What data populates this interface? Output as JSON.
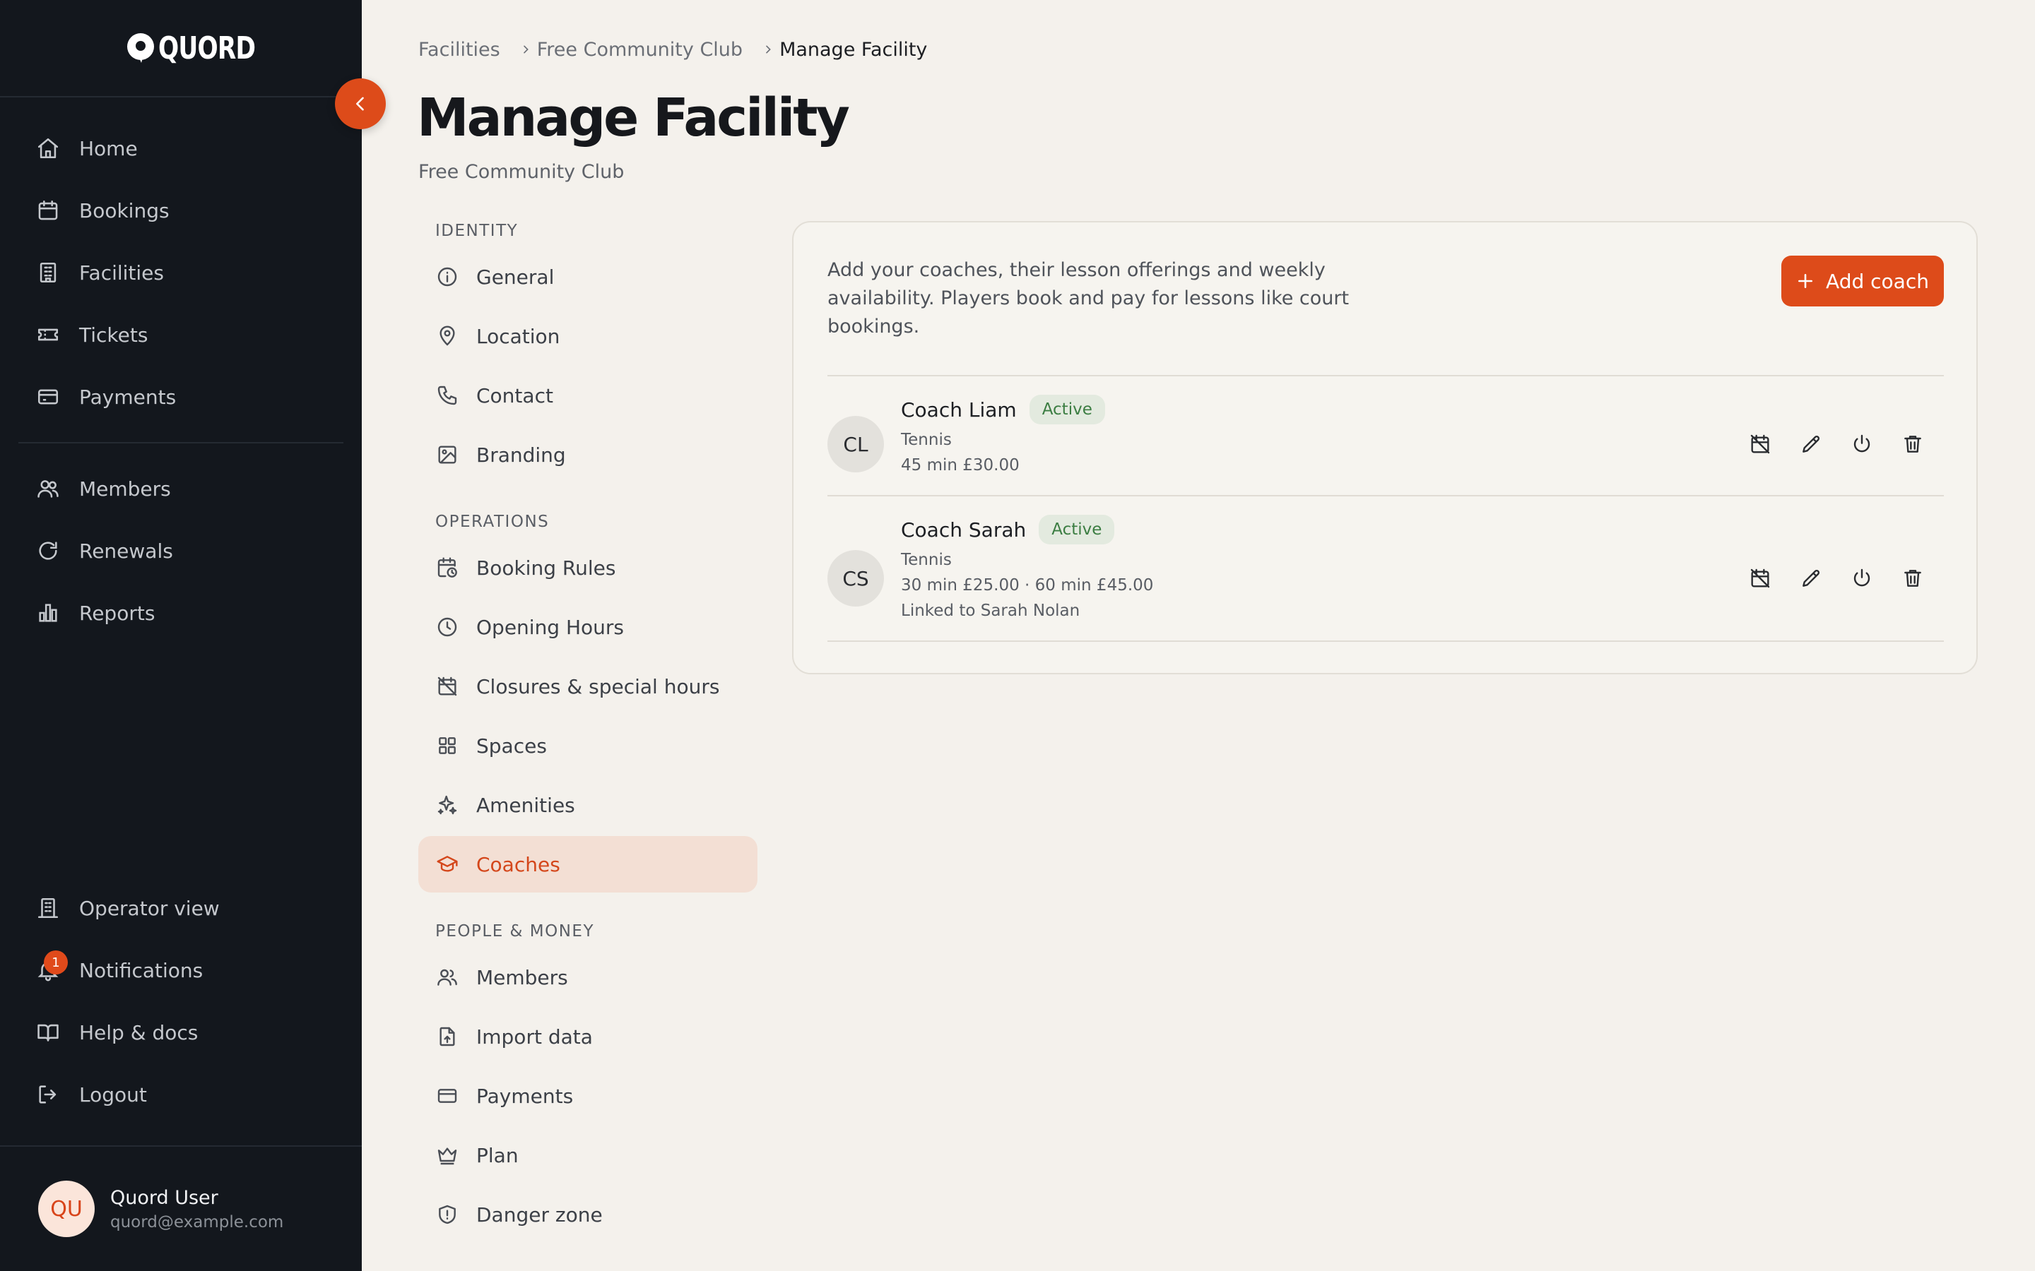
{
  "app": {
    "brand": "QUORD"
  },
  "sidebar": {
    "primary_items": [
      {
        "label": "Home",
        "icon": "home-icon"
      },
      {
        "label": "Bookings",
        "icon": "calendar-icon"
      },
      {
        "label": "Facilities",
        "icon": "building-icon"
      },
      {
        "label": "Tickets",
        "icon": "ticket-icon"
      },
      {
        "label": "Payments",
        "icon": "card-icon"
      }
    ],
    "secondary_items": [
      {
        "label": "Members",
        "icon": "users-icon"
      },
      {
        "label": "Renewals",
        "icon": "refresh-icon"
      },
      {
        "label": "Reports",
        "icon": "bar-chart-icon"
      }
    ],
    "bottom_items": [
      {
        "label": "Operator view",
        "icon": "building-icon"
      },
      {
        "label": "Notifications",
        "icon": "bell-icon",
        "badge": "1"
      },
      {
        "label": "Help & docs",
        "icon": "book-icon"
      },
      {
        "label": "Logout",
        "icon": "logout-icon"
      }
    ],
    "user": {
      "initials": "QU",
      "name": "Quord User",
      "email": "quord@example.com"
    }
  },
  "breadcrumb": [
    "Facilities",
    "Free Community Club",
    "Manage Facility"
  ],
  "page": {
    "title": "Manage Facility",
    "subtitle": "Free Community Club"
  },
  "settings_nav": {
    "sections": [
      {
        "label": "IDENTITY",
        "items": [
          {
            "label": "General",
            "icon": "info-icon"
          },
          {
            "label": "Location",
            "icon": "map-pin-icon"
          },
          {
            "label": "Contact",
            "icon": "phone-icon"
          },
          {
            "label": "Branding",
            "icon": "image-icon"
          }
        ]
      },
      {
        "label": "OPERATIONS",
        "items": [
          {
            "label": "Booking Rules",
            "icon": "calendar-clock-icon"
          },
          {
            "label": "Opening Hours",
            "icon": "clock-icon"
          },
          {
            "label": "Closures & special hours",
            "icon": "calendar-off-icon"
          },
          {
            "label": "Spaces",
            "icon": "grid-icon"
          },
          {
            "label": "Amenities",
            "icon": "sparkles-icon"
          },
          {
            "label": "Coaches",
            "icon": "graduation-cap-icon",
            "active": true
          }
        ]
      },
      {
        "label": "PEOPLE & MONEY",
        "items": [
          {
            "label": "Members",
            "icon": "users-icon"
          },
          {
            "label": "Import data",
            "icon": "file-upload-icon"
          },
          {
            "label": "Payments",
            "icon": "card-icon"
          },
          {
            "label": "Plan",
            "icon": "crown-icon"
          },
          {
            "label": "Danger zone",
            "icon": "shield-alert-icon"
          }
        ]
      }
    ]
  },
  "coaches_panel": {
    "description": "Add your coaches, their lesson offerings and weekly availability. Players book and pay for lessons like court bookings.",
    "add_button_label": "Add coach",
    "coaches": [
      {
        "initials": "CL",
        "name": "Coach Liam",
        "status": "Active",
        "sport": "Tennis",
        "pricing": "45 min £30.00",
        "linked": ""
      },
      {
        "initials": "CS",
        "name": "Coach Sarah",
        "status": "Active",
        "sport": "Tennis",
        "pricing": "30 min £25.00 · 60 min £45.00",
        "linked": "Linked to Sarah Nolan"
      }
    ],
    "row_actions": [
      "calendar-off-icon",
      "pencil-icon",
      "power-icon",
      "trash-icon"
    ]
  },
  "colors": {
    "sidebar_bg": "#13171d",
    "page_bg": "#f4f1ec",
    "accent": "#dd4b1a",
    "active_nav_bg": "#f3dfd4",
    "status_active_bg": "#e3eadf",
    "status_active_text": "#3b7d42"
  }
}
